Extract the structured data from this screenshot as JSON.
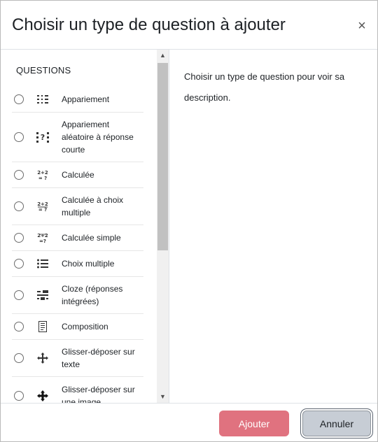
{
  "dialog": {
    "title": "Choisir un type de question à ajouter",
    "close_glyph": "×"
  },
  "left_panel": {
    "section_title": "QUESTIONS",
    "items": [
      {
        "label": "Appariement",
        "icon": "matching-icon"
      },
      {
        "label": "Appariement aléatoire à réponse courte",
        "icon": "random-matching-icon"
      },
      {
        "label": "Calculée",
        "icon": "calculated-icon"
      },
      {
        "label": "Calculée à choix multiple",
        "icon": "calculated-multichoice-icon"
      },
      {
        "label": "Calculée simple",
        "icon": "calculated-simple-icon"
      },
      {
        "label": "Choix multiple",
        "icon": "multichoice-icon"
      },
      {
        "label": "Cloze (réponses intégrées)",
        "icon": "cloze-icon"
      },
      {
        "label": "Composition",
        "icon": "essay-icon"
      },
      {
        "label": "Glisser-déposer sur texte",
        "icon": "drag-drop-text-icon"
      },
      {
        "label": "Glisser-déposer sur une image",
        "icon": "drag-drop-image-icon"
      }
    ]
  },
  "right_panel": {
    "description": "Choisir un type de question pour voir sa description."
  },
  "footer": {
    "add_label": "Ajouter",
    "cancel_label": "Annuler"
  },
  "colors": {
    "primary_button": "#e0727f",
    "secondary_button": "#c7cdd5"
  }
}
